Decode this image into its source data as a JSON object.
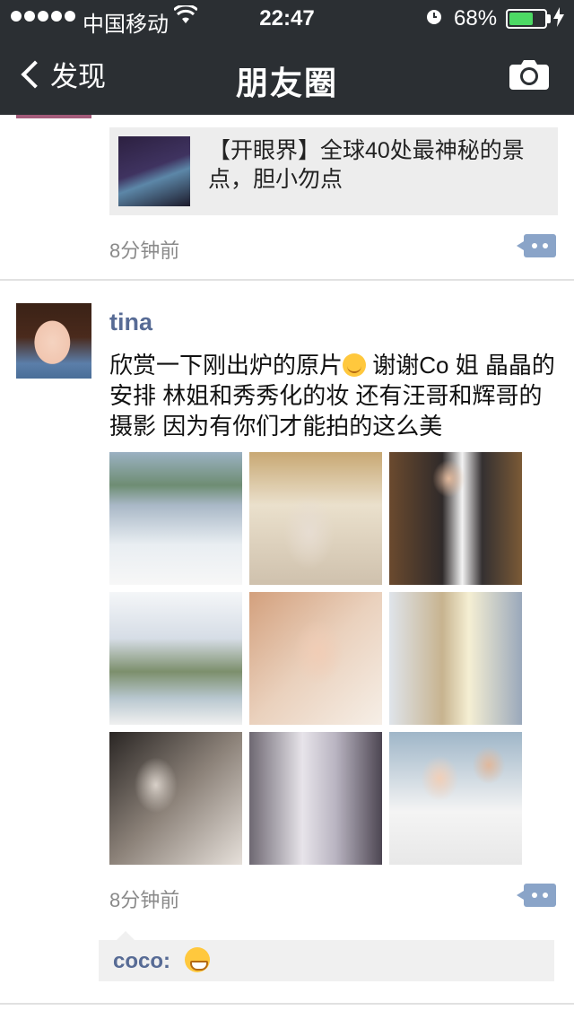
{
  "status_bar": {
    "carrier": "中国移动",
    "wifi_icon": "wifi-icon",
    "time": "22:47",
    "alarm_icon": "alarm-icon",
    "battery_percent": "68%",
    "battery_level": 0.68,
    "charging_icon": "lightning-icon"
  },
  "nav": {
    "back_label": "发现",
    "title": "朋友圈",
    "camera_icon": "camera-icon"
  },
  "feed": {
    "post1": {
      "link_title": "【开眼界】全球40处最神秘的景点，胆小勿点",
      "time": "8分钟前"
    },
    "post2": {
      "username": "tina",
      "text_before_emoji": "欣赏一下刚出炉的原片",
      "text_after_emoji": " 谢谢Co 姐 晶晶的安排 林姐和秀秀化的妆 还有汪哥和辉哥的摄影 因为有你们才能拍的这么美",
      "emoji": "heart-eyes-emoji",
      "time": "8分钟前",
      "comments": [
        {
          "user": "coco",
          "separator": ":",
          "emoji": "grin-emoji"
        }
      ]
    }
  },
  "colors": {
    "header_bg": "#2b2f33",
    "link_blue": "#576b95",
    "comment_button": "#8aa4c8",
    "battery_green": "#4cd964"
  }
}
